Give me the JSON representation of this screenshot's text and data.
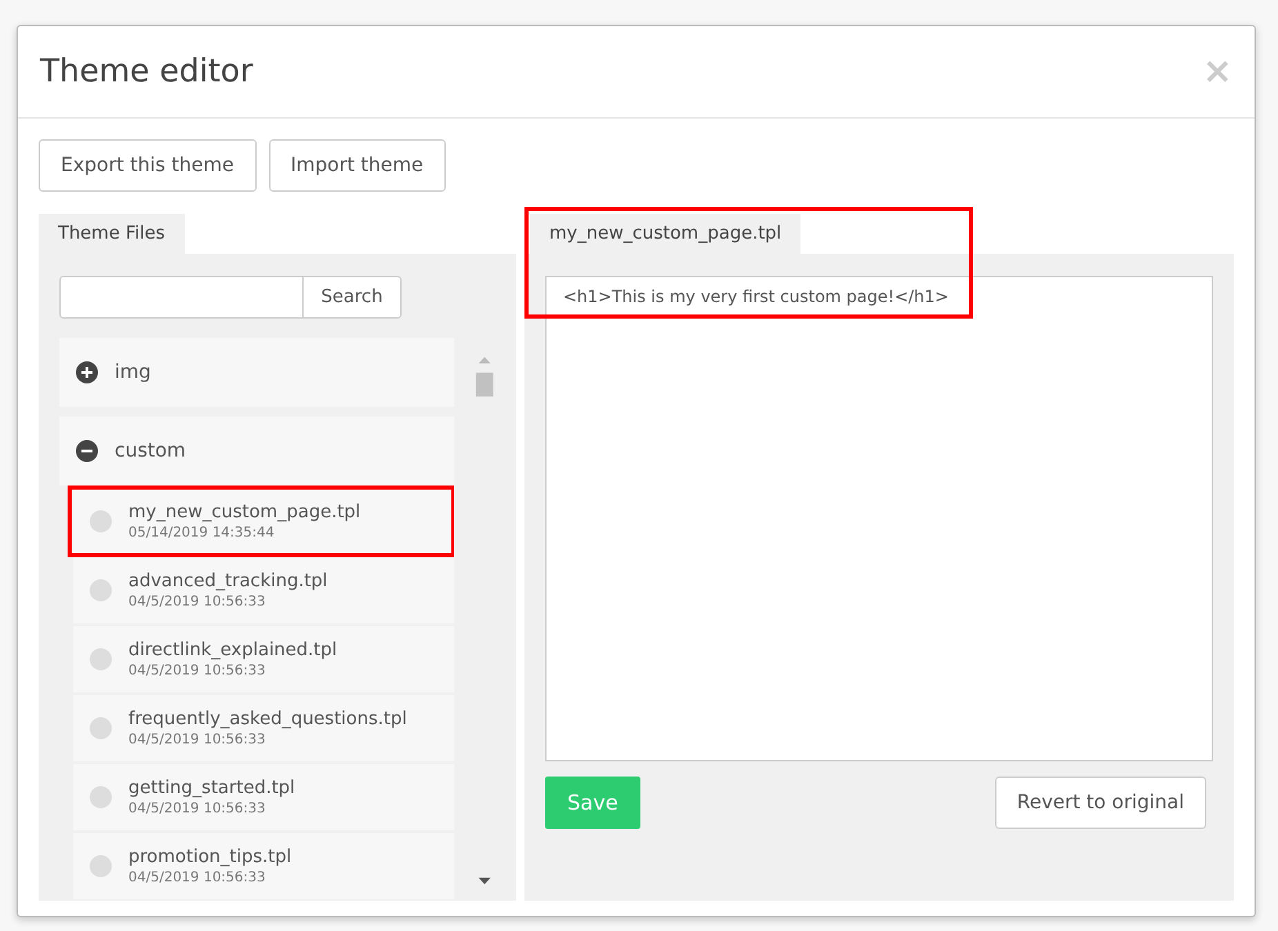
{
  "dialog": {
    "title": "Theme editor",
    "close": "×"
  },
  "actions": [
    "Export this theme",
    "Import theme"
  ],
  "files_panel": {
    "tab": "Theme Files",
    "search": {
      "button": "Search"
    },
    "folders": [
      {
        "name": "img",
        "expanded": false
      },
      {
        "name": "custom",
        "expanded": true,
        "children": [
          {
            "name": "my_new_custom_page.tpl",
            "date": "05/14/2019 14:35:44",
            "highlighted": true
          },
          {
            "name": "advanced_tracking.tpl",
            "date": "04/5/2019 10:56:33",
            "highlighted": false
          },
          {
            "name": "directlink_explained.tpl",
            "date": "04/5/2019 10:56:33",
            "highlighted": false
          },
          {
            "name": "frequently_asked_questions.tpl",
            "date": "04/5/2019 10:56:33",
            "highlighted": false
          },
          {
            "name": "getting_started.tpl",
            "date": "04/5/2019 10:56:33",
            "highlighted": false
          },
          {
            "name": "promotion_tips.tpl",
            "date": "04/5/2019 10:56:33",
            "highlighted": false
          }
        ]
      }
    ]
  },
  "editor": {
    "tab": "my_new_custom_page.tpl",
    "highlighted": true,
    "content": "<h1>This is my very first custom page!</h1>",
    "save": "Save",
    "revert": "Revert to original"
  }
}
